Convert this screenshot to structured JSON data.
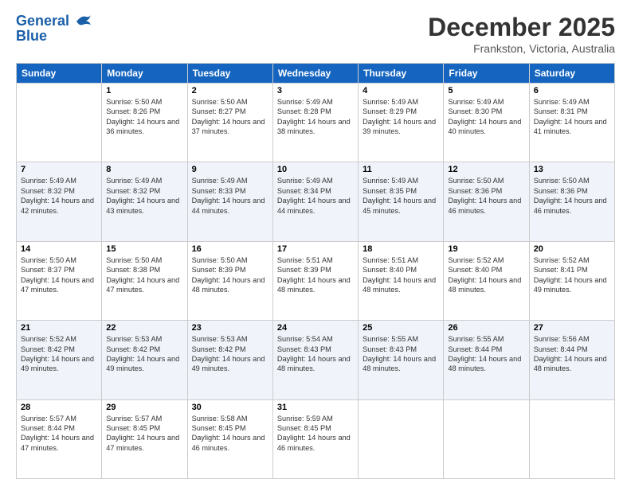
{
  "logo": {
    "line1": "General",
    "line2": "Blue"
  },
  "header": {
    "month": "December 2025",
    "location": "Frankston, Victoria, Australia"
  },
  "weekdays": [
    "Sunday",
    "Monday",
    "Tuesday",
    "Wednesday",
    "Thursday",
    "Friday",
    "Saturday"
  ],
  "weeks": [
    [
      {
        "day": "",
        "sunrise": "",
        "sunset": "",
        "daylight": ""
      },
      {
        "day": "1",
        "sunrise": "Sunrise: 5:50 AM",
        "sunset": "Sunset: 8:26 PM",
        "daylight": "Daylight: 14 hours and 36 minutes."
      },
      {
        "day": "2",
        "sunrise": "Sunrise: 5:50 AM",
        "sunset": "Sunset: 8:27 PM",
        "daylight": "Daylight: 14 hours and 37 minutes."
      },
      {
        "day": "3",
        "sunrise": "Sunrise: 5:49 AM",
        "sunset": "Sunset: 8:28 PM",
        "daylight": "Daylight: 14 hours and 38 minutes."
      },
      {
        "day": "4",
        "sunrise": "Sunrise: 5:49 AM",
        "sunset": "Sunset: 8:29 PM",
        "daylight": "Daylight: 14 hours and 39 minutes."
      },
      {
        "day": "5",
        "sunrise": "Sunrise: 5:49 AM",
        "sunset": "Sunset: 8:30 PM",
        "daylight": "Daylight: 14 hours and 40 minutes."
      },
      {
        "day": "6",
        "sunrise": "Sunrise: 5:49 AM",
        "sunset": "Sunset: 8:31 PM",
        "daylight": "Daylight: 14 hours and 41 minutes."
      }
    ],
    [
      {
        "day": "7",
        "sunrise": "Sunrise: 5:49 AM",
        "sunset": "Sunset: 8:32 PM",
        "daylight": "Daylight: 14 hours and 42 minutes."
      },
      {
        "day": "8",
        "sunrise": "Sunrise: 5:49 AM",
        "sunset": "Sunset: 8:32 PM",
        "daylight": "Daylight: 14 hours and 43 minutes."
      },
      {
        "day": "9",
        "sunrise": "Sunrise: 5:49 AM",
        "sunset": "Sunset: 8:33 PM",
        "daylight": "Daylight: 14 hours and 44 minutes."
      },
      {
        "day": "10",
        "sunrise": "Sunrise: 5:49 AM",
        "sunset": "Sunset: 8:34 PM",
        "daylight": "Daylight: 14 hours and 44 minutes."
      },
      {
        "day": "11",
        "sunrise": "Sunrise: 5:49 AM",
        "sunset": "Sunset: 8:35 PM",
        "daylight": "Daylight: 14 hours and 45 minutes."
      },
      {
        "day": "12",
        "sunrise": "Sunrise: 5:50 AM",
        "sunset": "Sunset: 8:36 PM",
        "daylight": "Daylight: 14 hours and 46 minutes."
      },
      {
        "day": "13",
        "sunrise": "Sunrise: 5:50 AM",
        "sunset": "Sunset: 8:36 PM",
        "daylight": "Daylight: 14 hours and 46 minutes."
      }
    ],
    [
      {
        "day": "14",
        "sunrise": "Sunrise: 5:50 AM",
        "sunset": "Sunset: 8:37 PM",
        "daylight": "Daylight: 14 hours and 47 minutes."
      },
      {
        "day": "15",
        "sunrise": "Sunrise: 5:50 AM",
        "sunset": "Sunset: 8:38 PM",
        "daylight": "Daylight: 14 hours and 47 minutes."
      },
      {
        "day": "16",
        "sunrise": "Sunrise: 5:50 AM",
        "sunset": "Sunset: 8:39 PM",
        "daylight": "Daylight: 14 hours and 48 minutes."
      },
      {
        "day": "17",
        "sunrise": "Sunrise: 5:51 AM",
        "sunset": "Sunset: 8:39 PM",
        "daylight": "Daylight: 14 hours and 48 minutes."
      },
      {
        "day": "18",
        "sunrise": "Sunrise: 5:51 AM",
        "sunset": "Sunset: 8:40 PM",
        "daylight": "Daylight: 14 hours and 48 minutes."
      },
      {
        "day": "19",
        "sunrise": "Sunrise: 5:52 AM",
        "sunset": "Sunset: 8:40 PM",
        "daylight": "Daylight: 14 hours and 48 minutes."
      },
      {
        "day": "20",
        "sunrise": "Sunrise: 5:52 AM",
        "sunset": "Sunset: 8:41 PM",
        "daylight": "Daylight: 14 hours and 49 minutes."
      }
    ],
    [
      {
        "day": "21",
        "sunrise": "Sunrise: 5:52 AM",
        "sunset": "Sunset: 8:42 PM",
        "daylight": "Daylight: 14 hours and 49 minutes."
      },
      {
        "day": "22",
        "sunrise": "Sunrise: 5:53 AM",
        "sunset": "Sunset: 8:42 PM",
        "daylight": "Daylight: 14 hours and 49 minutes."
      },
      {
        "day": "23",
        "sunrise": "Sunrise: 5:53 AM",
        "sunset": "Sunset: 8:42 PM",
        "daylight": "Daylight: 14 hours and 49 minutes."
      },
      {
        "day": "24",
        "sunrise": "Sunrise: 5:54 AM",
        "sunset": "Sunset: 8:43 PM",
        "daylight": "Daylight: 14 hours and 48 minutes."
      },
      {
        "day": "25",
        "sunrise": "Sunrise: 5:55 AM",
        "sunset": "Sunset: 8:43 PM",
        "daylight": "Daylight: 14 hours and 48 minutes."
      },
      {
        "day": "26",
        "sunrise": "Sunrise: 5:55 AM",
        "sunset": "Sunset: 8:44 PM",
        "daylight": "Daylight: 14 hours and 48 minutes."
      },
      {
        "day": "27",
        "sunrise": "Sunrise: 5:56 AM",
        "sunset": "Sunset: 8:44 PM",
        "daylight": "Daylight: 14 hours and 48 minutes."
      }
    ],
    [
      {
        "day": "28",
        "sunrise": "Sunrise: 5:57 AM",
        "sunset": "Sunset: 8:44 PM",
        "daylight": "Daylight: 14 hours and 47 minutes."
      },
      {
        "day": "29",
        "sunrise": "Sunrise: 5:57 AM",
        "sunset": "Sunset: 8:45 PM",
        "daylight": "Daylight: 14 hours and 47 minutes."
      },
      {
        "day": "30",
        "sunrise": "Sunrise: 5:58 AM",
        "sunset": "Sunset: 8:45 PM",
        "daylight": "Daylight: 14 hours and 46 minutes."
      },
      {
        "day": "31",
        "sunrise": "Sunrise: 5:59 AM",
        "sunset": "Sunset: 8:45 PM",
        "daylight": "Daylight: 14 hours and 46 minutes."
      },
      {
        "day": "",
        "sunrise": "",
        "sunset": "",
        "daylight": ""
      },
      {
        "day": "",
        "sunrise": "",
        "sunset": "",
        "daylight": ""
      },
      {
        "day": "",
        "sunrise": "",
        "sunset": "",
        "daylight": ""
      }
    ]
  ]
}
